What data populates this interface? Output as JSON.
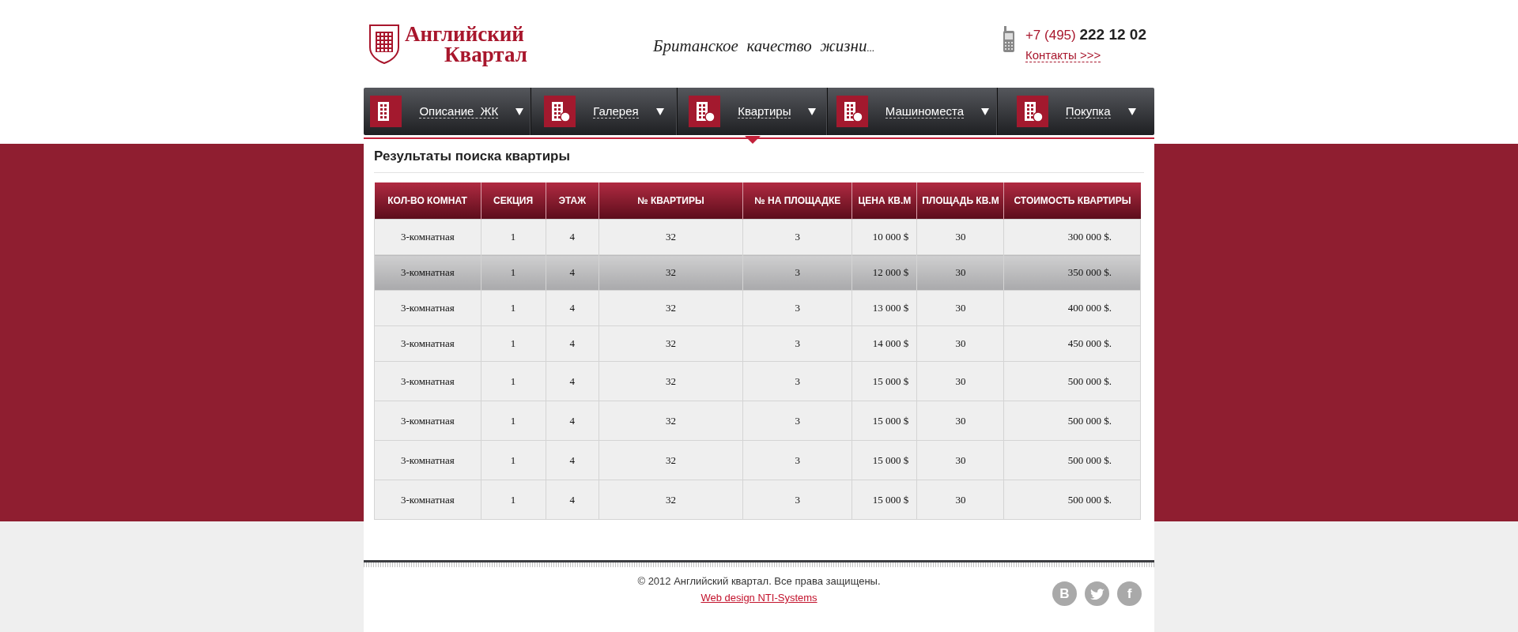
{
  "logo": {
    "line1": "Английский",
    "line2": "Квартал"
  },
  "slogan": "Британское  качество  жизни",
  "slogan_ellipsis": "...",
  "phone": {
    "code": "+7 (495)",
    "number": "222 12 02"
  },
  "contacts_link": "Контакты >>>",
  "nav": [
    {
      "label": "Описание  ЖК",
      "selected": false
    },
    {
      "label": "Галерея",
      "selected": false
    },
    {
      "label": "Квартиры",
      "selected": true
    },
    {
      "label": "Машиноместа",
      "selected": false
    },
    {
      "label": "Покупка",
      "selected": false
    }
  ],
  "page_title": "Результаты поиска квартиры",
  "table": {
    "columns": [
      "КОЛ-ВО КОМНАТ",
      "СЕКЦИЯ",
      "ЭТАЖ",
      "№ КВАРТИРЫ",
      "№ НА ПЛОЩАДКЕ",
      "ЦЕНА КВ.М",
      "ПЛОЩАДЬ  КВ.М",
      "СТОИМОСТЬ КВАРТИРЫ"
    ],
    "rows": [
      {
        "selected": false,
        "cells": [
          "3-комнатная",
          "1",
          "4",
          "32",
          "3",
          "10 000 $",
          "30",
          "300 000 $."
        ]
      },
      {
        "selected": true,
        "cells": [
          "3-комнатная",
          "1",
          "4",
          "32",
          "3",
          "12 000 $",
          "30",
          "350 000 $."
        ]
      },
      {
        "selected": false,
        "cells": [
          "3-комнатная",
          "1",
          "4",
          "32",
          "3",
          "13 000 $",
          "30",
          "400 000 $."
        ]
      },
      {
        "selected": false,
        "cells": [
          "3-комнатная",
          "1",
          "4",
          "32",
          "3",
          "14 000 $",
          "30",
          "450 000 $."
        ]
      },
      {
        "selected": false,
        "cells": [
          "3-комнатная",
          "1",
          "4",
          "32",
          "3",
          "15 000 $",
          "30",
          "500 000 $."
        ]
      },
      {
        "selected": false,
        "cells": [
          "3-комнатная",
          "1",
          "4",
          "32",
          "3",
          "15 000 $",
          "30",
          "500 000 $."
        ]
      },
      {
        "selected": false,
        "cells": [
          "3-комнатная",
          "1",
          "4",
          "32",
          "3",
          "15 000 $",
          "30",
          "500 000 $."
        ]
      },
      {
        "selected": false,
        "cells": [
          "3-комнатная",
          "1",
          "4",
          "32",
          "3",
          "15 000 $",
          "30",
          "500 000 $."
        ]
      }
    ]
  },
  "footer": {
    "copyright": "© 2012 Английский квартал. Все права защищены.",
    "credit_link": "Web design NTI-Systems",
    "social": [
      {
        "kind": "vk",
        "label": "B"
      },
      {
        "kind": "twitter"
      },
      {
        "kind": "facebook",
        "label": "f"
      }
    ]
  }
}
